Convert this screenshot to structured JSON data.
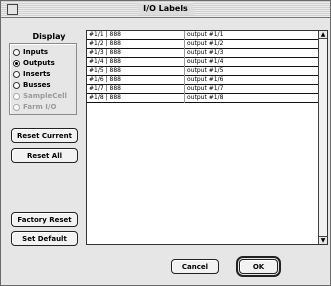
{
  "window": {
    "title": "I/O Labels"
  },
  "display": {
    "label": "Display",
    "options": [
      {
        "label": "Inputs",
        "checked": false,
        "disabled": false
      },
      {
        "label": "Outputs",
        "checked": true,
        "disabled": false
      },
      {
        "label": "Inserts",
        "checked": false,
        "disabled": false
      },
      {
        "label": "Busses",
        "checked": false,
        "disabled": false
      },
      {
        "label": "SampleCell",
        "checked": false,
        "disabled": true
      },
      {
        "label": "Farm I/O",
        "checked": false,
        "disabled": true
      }
    ]
  },
  "buttons": {
    "reset_current": "Reset Current",
    "reset_all": "Reset All",
    "factory_reset": "Factory Reset",
    "set_default": "Set Default",
    "cancel": "Cancel",
    "ok": "OK"
  },
  "labels_list": {
    "rows": [
      {
        "device": "#1/1 | 888",
        "name": "output #1/1"
      },
      {
        "device": "#1/2 | 888",
        "name": "output #1/2"
      },
      {
        "device": "#1/3 | 888",
        "name": "output #1/3"
      },
      {
        "device": "#1/4 | 888",
        "name": "output #1/4"
      },
      {
        "device": "#1/5 | 888",
        "name": "output #1/5"
      },
      {
        "device": "#1/6 | 888",
        "name": "output #1/6"
      },
      {
        "device": "#1/7 | 888",
        "name": "output #1/7"
      },
      {
        "device": "#1/8 | 888",
        "name": "output #1/8"
      }
    ]
  }
}
